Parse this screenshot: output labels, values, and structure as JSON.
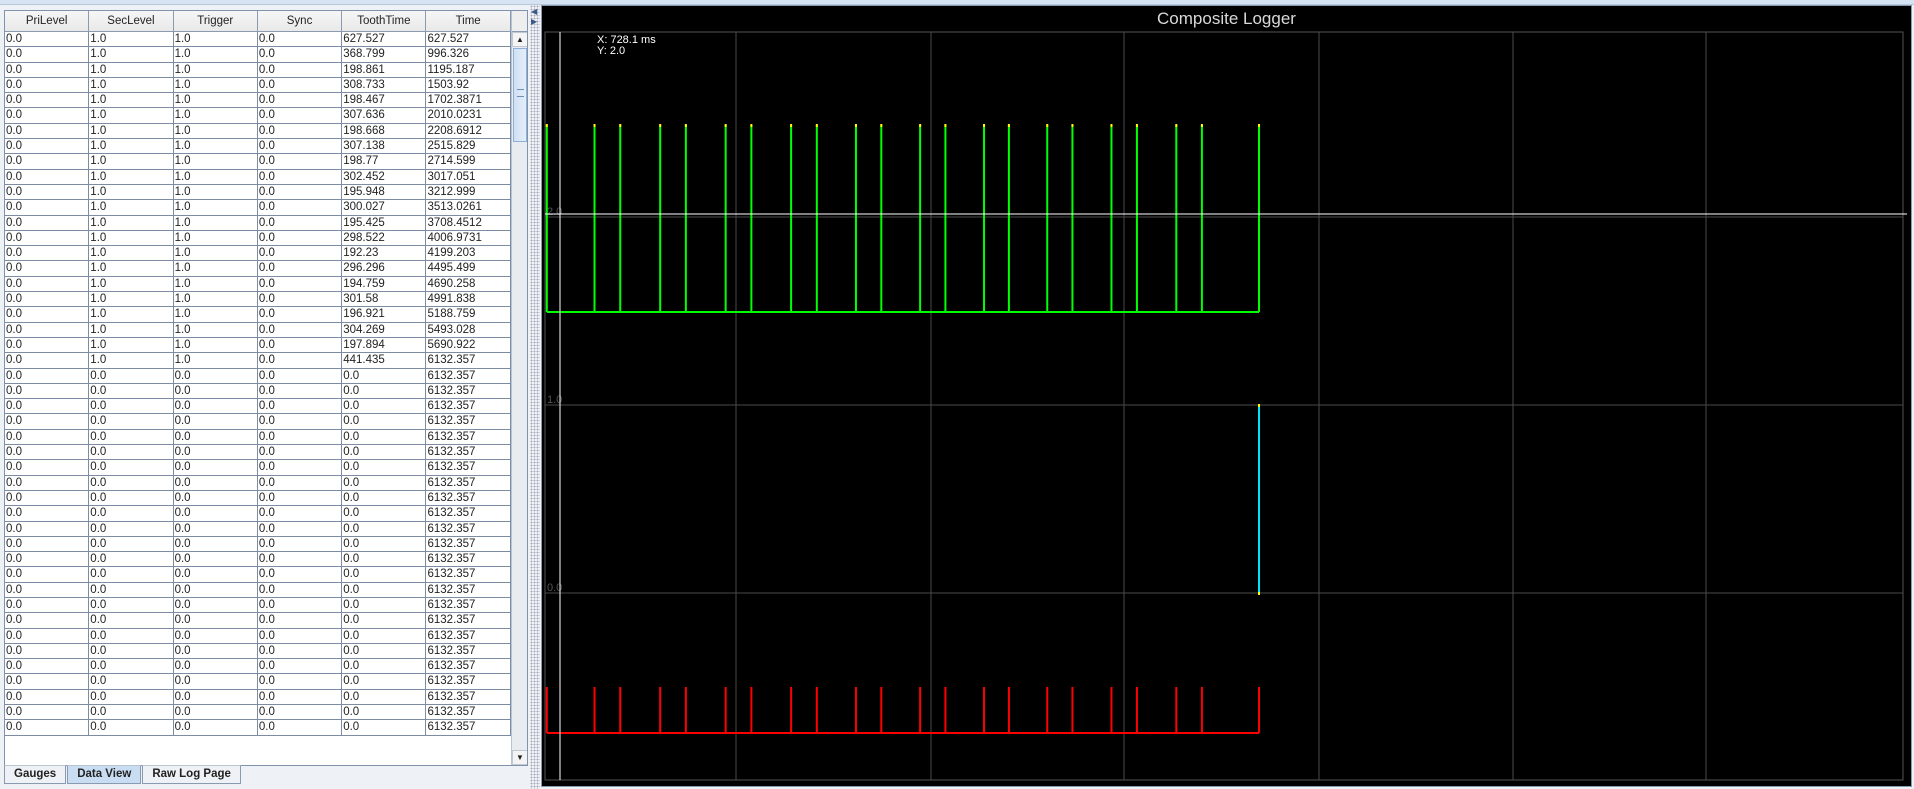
{
  "table": {
    "columns": [
      "PriLevel",
      "SecLevel",
      "Trigger",
      "Sync",
      "ToothTime",
      "Time"
    ],
    "rows": [
      [
        "0.0",
        "1.0",
        "1.0",
        "0.0",
        "627.527",
        "627.527"
      ],
      [
        "0.0",
        "1.0",
        "1.0",
        "0.0",
        "368.799",
        "996.326"
      ],
      [
        "0.0",
        "1.0",
        "1.0",
        "0.0",
        "198.861",
        "1195.187"
      ],
      [
        "0.0",
        "1.0",
        "1.0",
        "0.0",
        "308.733",
        "1503.92"
      ],
      [
        "0.0",
        "1.0",
        "1.0",
        "0.0",
        "198.467",
        "1702.3871"
      ],
      [
        "0.0",
        "1.0",
        "1.0",
        "0.0",
        "307.636",
        "2010.0231"
      ],
      [
        "0.0",
        "1.0",
        "1.0",
        "0.0",
        "198.668",
        "2208.6912"
      ],
      [
        "0.0",
        "1.0",
        "1.0",
        "0.0",
        "307.138",
        "2515.829"
      ],
      [
        "0.0",
        "1.0",
        "1.0",
        "0.0",
        "198.77",
        "2714.599"
      ],
      [
        "0.0",
        "1.0",
        "1.0",
        "0.0",
        "302.452",
        "3017.051"
      ],
      [
        "0.0",
        "1.0",
        "1.0",
        "0.0",
        "195.948",
        "3212.999"
      ],
      [
        "0.0",
        "1.0",
        "1.0",
        "0.0",
        "300.027",
        "3513.0261"
      ],
      [
        "0.0",
        "1.0",
        "1.0",
        "0.0",
        "195.425",
        "3708.4512"
      ],
      [
        "0.0",
        "1.0",
        "1.0",
        "0.0",
        "298.522",
        "4006.9731"
      ],
      [
        "0.0",
        "1.0",
        "1.0",
        "0.0",
        "192.23",
        "4199.203"
      ],
      [
        "0.0",
        "1.0",
        "1.0",
        "0.0",
        "296.296",
        "4495.499"
      ],
      [
        "0.0",
        "1.0",
        "1.0",
        "0.0",
        "194.759",
        "4690.258"
      ],
      [
        "0.0",
        "1.0",
        "1.0",
        "0.0",
        "301.58",
        "4991.838"
      ],
      [
        "0.0",
        "1.0",
        "1.0",
        "0.0",
        "196.921",
        "5188.759"
      ],
      [
        "0.0",
        "1.0",
        "1.0",
        "0.0",
        "304.269",
        "5493.028"
      ],
      [
        "0.0",
        "1.0",
        "1.0",
        "0.0",
        "197.894",
        "5690.922"
      ],
      [
        "0.0",
        "1.0",
        "1.0",
        "0.0",
        "441.435",
        "6132.357"
      ],
      [
        "0.0",
        "0.0",
        "0.0",
        "0.0",
        "0.0",
        "6132.357"
      ],
      [
        "0.0",
        "0.0",
        "0.0",
        "0.0",
        "0.0",
        "6132.357"
      ],
      [
        "0.0",
        "0.0",
        "0.0",
        "0.0",
        "0.0",
        "6132.357"
      ],
      [
        "0.0",
        "0.0",
        "0.0",
        "0.0",
        "0.0",
        "6132.357"
      ],
      [
        "0.0",
        "0.0",
        "0.0",
        "0.0",
        "0.0",
        "6132.357"
      ],
      [
        "0.0",
        "0.0",
        "0.0",
        "0.0",
        "0.0",
        "6132.357"
      ],
      [
        "0.0",
        "0.0",
        "0.0",
        "0.0",
        "0.0",
        "6132.357"
      ],
      [
        "0.0",
        "0.0",
        "0.0",
        "0.0",
        "0.0",
        "6132.357"
      ],
      [
        "0.0",
        "0.0",
        "0.0",
        "0.0",
        "0.0",
        "6132.357"
      ],
      [
        "0.0",
        "0.0",
        "0.0",
        "0.0",
        "0.0",
        "6132.357"
      ],
      [
        "0.0",
        "0.0",
        "0.0",
        "0.0",
        "0.0",
        "6132.357"
      ],
      [
        "0.0",
        "0.0",
        "0.0",
        "0.0",
        "0.0",
        "6132.357"
      ],
      [
        "0.0",
        "0.0",
        "0.0",
        "0.0",
        "0.0",
        "6132.357"
      ],
      [
        "0.0",
        "0.0",
        "0.0",
        "0.0",
        "0.0",
        "6132.357"
      ],
      [
        "0.0",
        "0.0",
        "0.0",
        "0.0",
        "0.0",
        "6132.357"
      ],
      [
        "0.0",
        "0.0",
        "0.0",
        "0.0",
        "0.0",
        "6132.357"
      ],
      [
        "0.0",
        "0.0",
        "0.0",
        "0.0",
        "0.0",
        "6132.357"
      ],
      [
        "0.0",
        "0.0",
        "0.0",
        "0.0",
        "0.0",
        "6132.357"
      ],
      [
        "0.0",
        "0.0",
        "0.0",
        "0.0",
        "0.0",
        "6132.357"
      ],
      [
        "0.0",
        "0.0",
        "0.0",
        "0.0",
        "0.0",
        "6132.357"
      ],
      [
        "0.0",
        "0.0",
        "0.0",
        "0.0",
        "0.0",
        "6132.357"
      ],
      [
        "0.0",
        "0.0",
        "0.0",
        "0.0",
        "0.0",
        "6132.357"
      ],
      [
        "0.0",
        "0.0",
        "0.0",
        "0.0",
        "0.0",
        "6132.357"
      ],
      [
        "0.0",
        "0.0",
        "0.0",
        "0.0",
        "0.0",
        "6132.357"
      ]
    ]
  },
  "tabs": [
    {
      "label": "Gauges",
      "active": false
    },
    {
      "label": "Data View",
      "active": true
    },
    {
      "label": "Raw Log Page",
      "active": false
    }
  ],
  "chart_data": {
    "type": "line",
    "title": "Composite Logger",
    "cursor": {
      "x_label": "X: 728.1 ms",
      "y_label": "Y: 2.0"
    },
    "y_tick_labels": [
      "2.0",
      "1.0",
      "0.0"
    ],
    "grid": true,
    "background": "#000000",
    "pulse_times_ms": [
      627.527,
      996.326,
      1195.187,
      1503.92,
      1702.3871,
      2010.0231,
      2208.6912,
      2515.829,
      2714.599,
      3017.051,
      3212.999,
      3513.0261,
      3708.4512,
      4006.9731,
      4199.203,
      4495.499,
      4690.258,
      4991.838,
      5188.759,
      5493.028,
      5690.922,
      6132.357
    ],
    "series": [
      {
        "trace": "top",
        "color": "#00ff00",
        "tip_color": "#ffff00"
      },
      {
        "trace": "middle",
        "color": "#00e5ff",
        "tip_color": "#ffff00",
        "event_time_ms": 6132.357
      },
      {
        "trace": "bottom",
        "color": "#ff0000"
      }
    ]
  }
}
